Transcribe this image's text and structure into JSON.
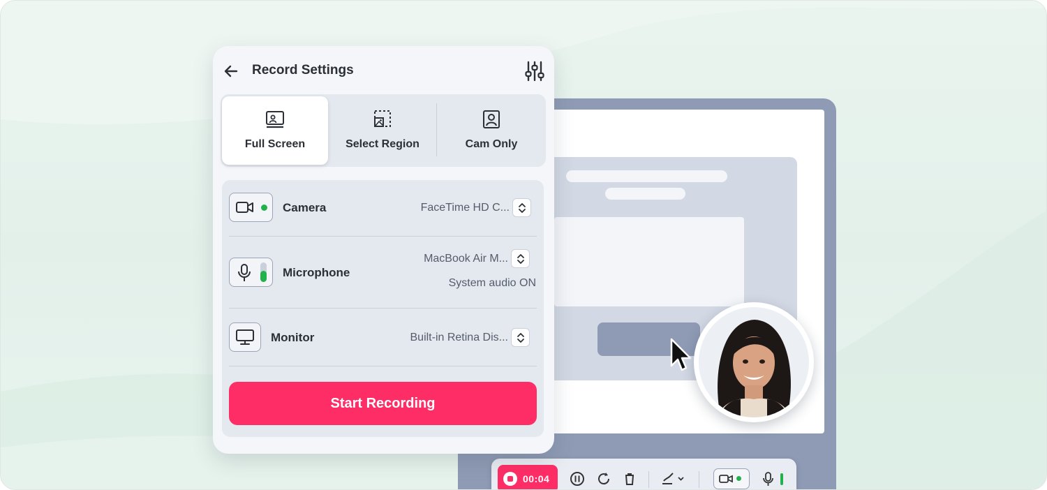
{
  "header": {
    "title": "Record Settings"
  },
  "modes": [
    {
      "label": "Full Screen",
      "icon": "monitor-user-icon",
      "active": true
    },
    {
      "label": "Select Region",
      "icon": "region-select-icon",
      "active": false
    },
    {
      "label": "Cam Only",
      "icon": "user-square-icon",
      "active": false
    }
  ],
  "devices": {
    "camera": {
      "label": "Camera",
      "value": "FaceTime HD C...",
      "status_color": "#22b14c"
    },
    "microphone": {
      "label": "Microphone",
      "value": "MacBook Air M...",
      "secondary": "System audio ON",
      "level_color": "#22b14c"
    },
    "monitor": {
      "label": "Monitor",
      "value": "Built-in Retina Dis..."
    }
  },
  "start_button": {
    "label": "Start Recording"
  },
  "toolbar": {
    "timer": "00:04"
  },
  "colors": {
    "accent": "#ff2d66",
    "active_green": "#22b14c"
  }
}
